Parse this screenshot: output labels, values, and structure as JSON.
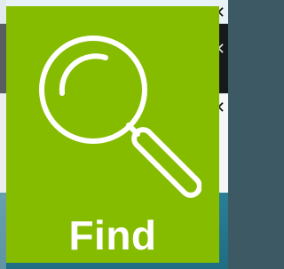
{
  "tile": {
    "label": "Find",
    "icon": "magnifying-glass-icon",
    "background_color": "#86bc00",
    "text_color": "#ffffff"
  },
  "background": {
    "close_glyph": "✕"
  }
}
